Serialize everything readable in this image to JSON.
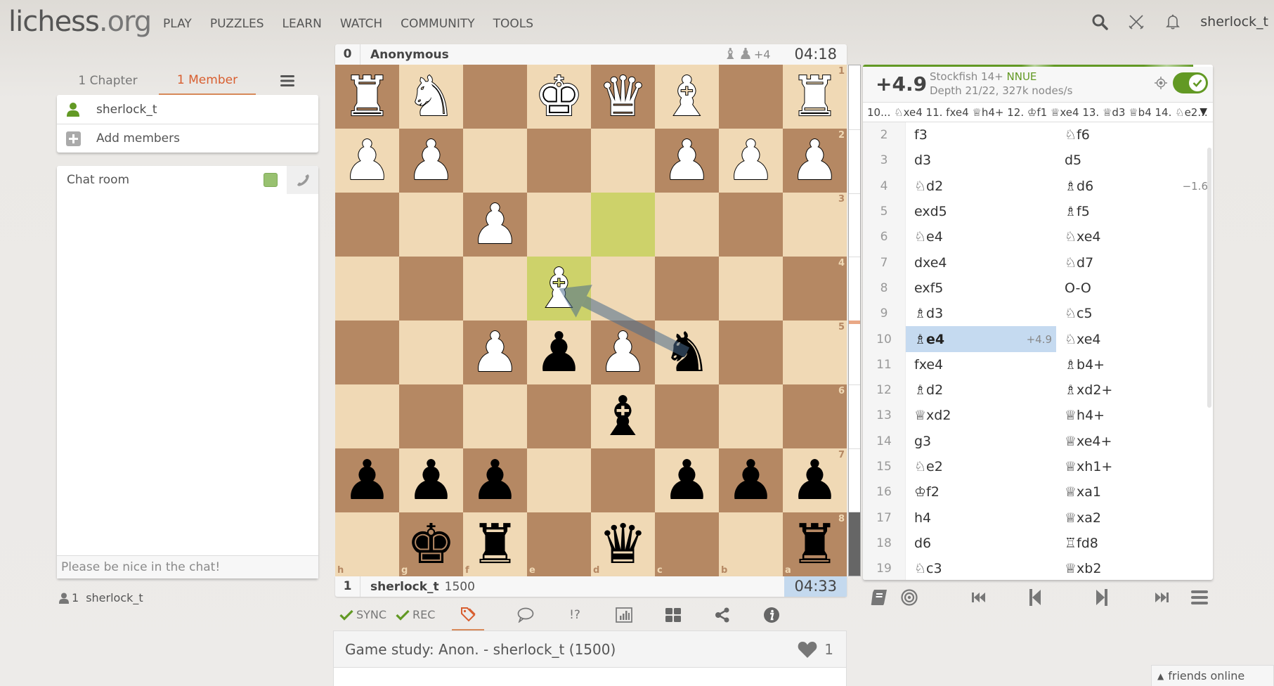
{
  "header": {
    "logo_main": "lichess",
    "logo_tld": ".org",
    "nav": [
      "PLAY",
      "PUZZLES",
      "LEARN",
      "WATCH",
      "COMMUNITY",
      "TOOLS"
    ],
    "username": "sherlock_t",
    "icons": [
      "search-icon",
      "crossed-swords-icon",
      "bell-icon"
    ]
  },
  "study_sidebar": {
    "tabs": [
      {
        "label": "1 Chapter",
        "active": false
      },
      {
        "label": "1 Member",
        "active": true
      }
    ],
    "members": [
      {
        "name": "sherlock_t",
        "online": true
      }
    ],
    "add_members_label": "Add members",
    "chat": {
      "title": "Chat room",
      "placeholder": "Please be nice in the chat!"
    },
    "spectators": {
      "count": "1",
      "names": "sherlock_t"
    }
  },
  "players": {
    "top": {
      "index": "0",
      "name": "Anonymous",
      "rating": "",
      "material_diff": "+4",
      "clock": "04:18",
      "captured": [
        "bishop",
        "pawn"
      ]
    },
    "bottom": {
      "index": "1",
      "name": "sherlock_t",
      "rating": "1500",
      "clock": "04:33",
      "clock_running": true
    }
  },
  "board": {
    "orientation": "black",
    "files_display": [
      "h",
      "g",
      "f",
      "e",
      "d",
      "c",
      "b",
      "a"
    ],
    "ranks_display": [
      "1",
      "2",
      "3",
      "4",
      "5",
      "6",
      "7",
      "8"
    ],
    "pieces": {
      "h1": "wR",
      "g1": "wN",
      "e1": "wK",
      "d1": "wQ",
      "c1": "wB",
      "a1": "wR",
      "h2": "wP",
      "g2": "wP",
      "c2": "wP",
      "b2": "wP",
      "a2": "wP",
      "f3": "wP",
      "e4": "wB",
      "f5": "wP",
      "e5": "bP",
      "d5": "wP",
      "c5": "bN",
      "d6": "bB",
      "h7": "bP",
      "g7": "bP",
      "f7": "bP",
      "c7": "bP",
      "b7": "bP",
      "a7": "bP",
      "g8": "bK",
      "f8": "bR",
      "d8": "bQ",
      "a8": "bR"
    },
    "last_move": [
      "d3",
      "e4"
    ],
    "arrow": {
      "from": "c5",
      "to": "e4"
    },
    "colors": {
      "light": "#f0d9b5",
      "dark": "#b58863",
      "highlight": "#cdd26a",
      "arrow": "#4a6b8c"
    }
  },
  "eval_gauge": {
    "white_fraction": 0.875
  },
  "engine": {
    "eval": "+4.9",
    "name": "Stockfish 14+",
    "variant": "NNUE",
    "depth": "Depth 21/22, 327k nodes/s",
    "enabled": true,
    "pv": "10... ♘xe4 11. fxe4 ♕h4+ 12. ♔f1 ♕xe4 13. ♕d3 ♕b4 14. ♘e2..."
  },
  "moves": [
    {
      "n": "2",
      "w": "f3",
      "b": "♘f6"
    },
    {
      "n": "3",
      "w": "d3",
      "b": "d5"
    },
    {
      "n": "4",
      "w": "♘d2",
      "b": "♗d6",
      "b_eval": "−1.6"
    },
    {
      "n": "5",
      "w": "exd5",
      "b": "♗f5"
    },
    {
      "n": "6",
      "w": "♘e4",
      "b": "♘xe4"
    },
    {
      "n": "7",
      "w": "dxe4",
      "b": "♘d7"
    },
    {
      "n": "8",
      "w": "exf5",
      "b": "O-O"
    },
    {
      "n": "9",
      "w": "♗d3",
      "b": "♘c5"
    },
    {
      "n": "10",
      "w": "♗e4",
      "w_eval": "+4.9",
      "w_active": true,
      "b": "♘xe4"
    },
    {
      "n": "11",
      "w": "fxe4",
      "b": "♗b4+"
    },
    {
      "n": "12",
      "w": "♗d2",
      "b": "♗xd2+"
    },
    {
      "n": "13",
      "w": "♕xd2",
      "b": "♕h4+"
    },
    {
      "n": "14",
      "w": "g3",
      "b": "♕xe4+"
    },
    {
      "n": "15",
      "w": "♘e2",
      "b": "♕xh1+"
    },
    {
      "n": "16",
      "w": "♔f2",
      "b": "♕xa1"
    },
    {
      "n": "17",
      "w": "h4",
      "b": "♕xa2"
    },
    {
      "n": "18",
      "w": "d6",
      "b": "♖fd8"
    },
    {
      "n": "19",
      "w": "♘c3",
      "b": "♕xb2"
    }
  ],
  "board_toolbar": {
    "sync_label": "SYNC",
    "rec_label": "REC",
    "tools": [
      "tags-icon",
      "comment-icon",
      "glyphs-icon",
      "chart-icon",
      "multiboard-icon",
      "share-icon",
      "info-icon"
    ],
    "glyph_text": "!?",
    "active_tool": "tags-icon"
  },
  "study": {
    "title": "Game study: Anon. - sherlock_t (1500)",
    "likes": "1"
  },
  "friends": {
    "label": "friends online"
  }
}
